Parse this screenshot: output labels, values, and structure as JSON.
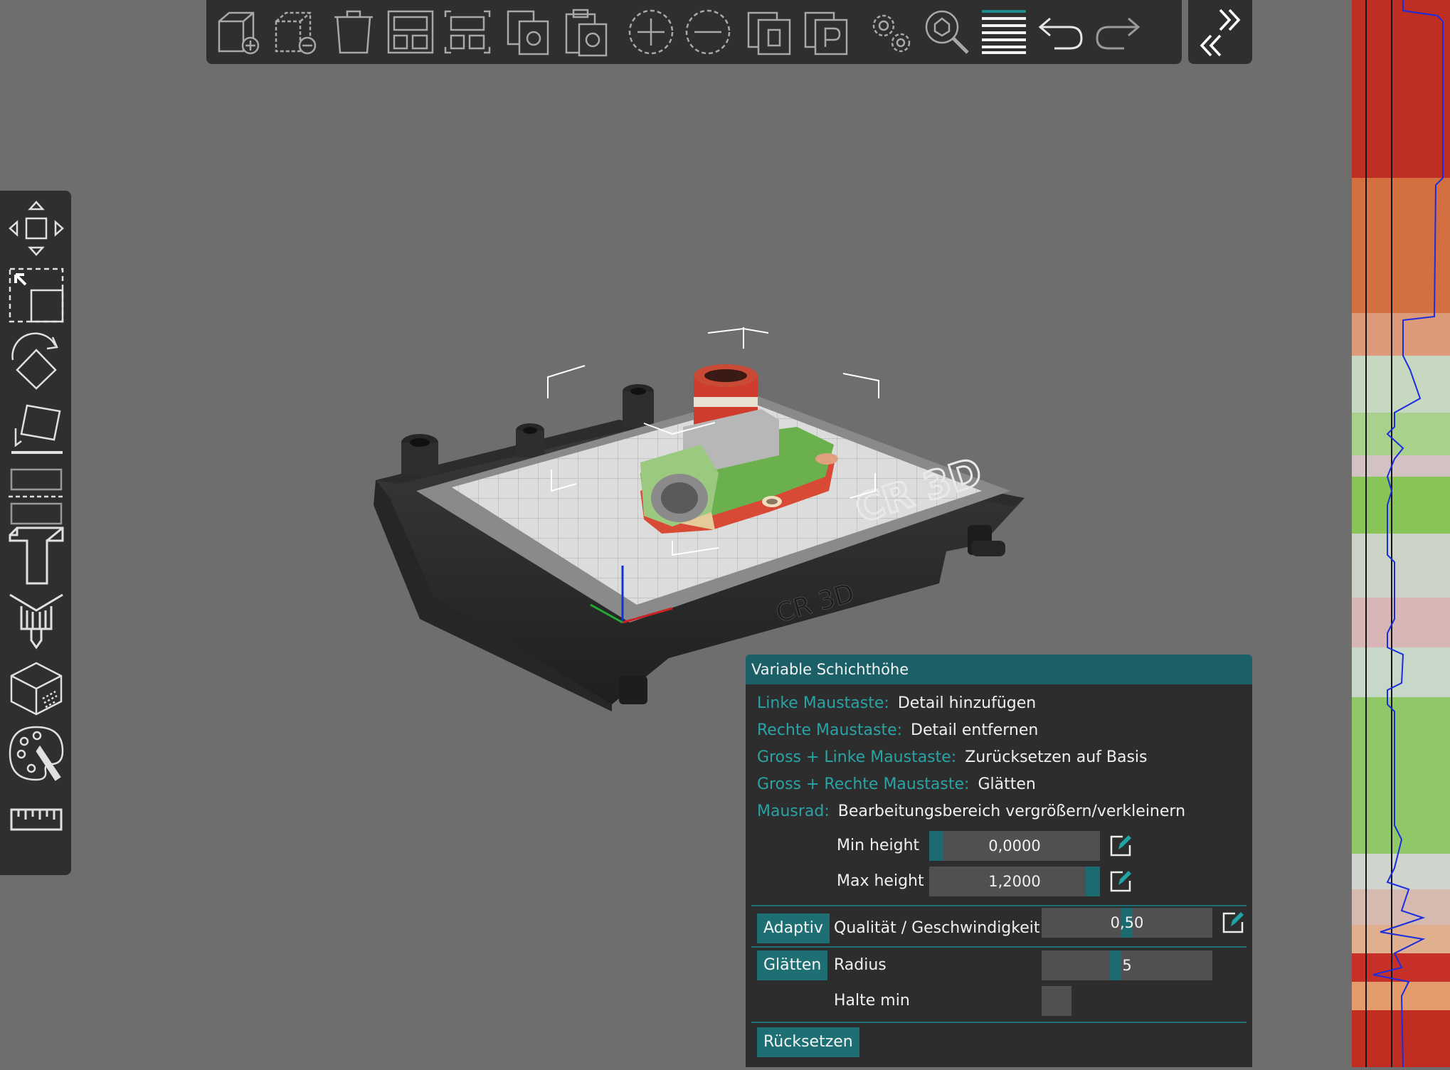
{
  "toolbar": {
    "buttons": [
      {
        "name": "add-model-button",
        "icon": "cube-plus-icon"
      },
      {
        "name": "remove-model-button",
        "icon": "cube-minus-icon"
      },
      {
        "name": "delete-button",
        "icon": "trash-icon"
      },
      {
        "name": "arrange-button",
        "icon": "arrange-icon"
      },
      {
        "name": "arrange-selection-button",
        "icon": "arrange-selection-icon"
      },
      {
        "name": "copy-button",
        "icon": "copy-icon"
      },
      {
        "name": "paste-button",
        "icon": "paste-icon"
      },
      {
        "name": "add-instance-button",
        "icon": "plus-circle-icon"
      },
      {
        "name": "remove-instance-button",
        "icon": "minus-circle-icon"
      },
      {
        "name": "split-objects-button",
        "icon": "split-objects-icon"
      },
      {
        "name": "split-parts-button",
        "icon": "split-parts-icon"
      },
      {
        "name": "settings-button",
        "icon": "gears-icon"
      },
      {
        "name": "search-button",
        "icon": "search-icon"
      },
      {
        "name": "layers-button",
        "icon": "layers-icon"
      },
      {
        "name": "undo-button",
        "icon": "undo-icon"
      },
      {
        "name": "redo-button",
        "icon": "redo-icon"
      }
    ],
    "collapse_icon": "collapse-arrows-icon"
  },
  "left_toolbar": {
    "tools": [
      "move-icon",
      "scale-icon",
      "rotate-icon",
      "place-on-face-icon",
      "cut-icon",
      "support-paint-icon",
      "seam-paint-icon",
      "hollow-icon",
      "color-paint-icon",
      "measure-icon"
    ]
  },
  "bed": {
    "logo_text": "CR 3D",
    "front_logo": "CR 3D"
  },
  "panel": {
    "title": "Variable Schichthöhe",
    "hints": [
      {
        "key": "Linke Maustaste:",
        "value": "Detail hinzufügen"
      },
      {
        "key": "Rechte Maustaste:",
        "value": "Detail entfernen"
      },
      {
        "key": "Gross + Linke Maustaste:",
        "value": "Zurücksetzen auf Basis"
      },
      {
        "key": "Gross + Rechte Maustaste:",
        "value": "Glätten"
      },
      {
        "key": "Mausrad:",
        "value": "Bearbeitungsbereich vergrößern/verkleinern"
      }
    ],
    "min_height": {
      "label": "Min height",
      "value": "0,0000",
      "fill": 0.0
    },
    "max_height": {
      "label": "Max height",
      "value": "1,2000",
      "fill": 1.0
    },
    "adaptive": {
      "button": "Adaptiv",
      "label": "Qualität / Geschwindigkeit",
      "value": "0,50",
      "fill": 0.5
    },
    "smooth": {
      "button": "Glätten",
      "radius_label": "Radius",
      "radius_value": "5",
      "radius_fill": 0.45,
      "keep_min_label": "Halte min",
      "keep_min_checked": false
    },
    "reset_button": "Rücksetzen"
  },
  "colors": {
    "accent": "#1e6f73",
    "hint_key": "#2aa3a5",
    "panel_bg": "#2d2d2d",
    "toolbar_bg": "#2f2f2f",
    "viewport_bg": "#6e6e6e"
  }
}
